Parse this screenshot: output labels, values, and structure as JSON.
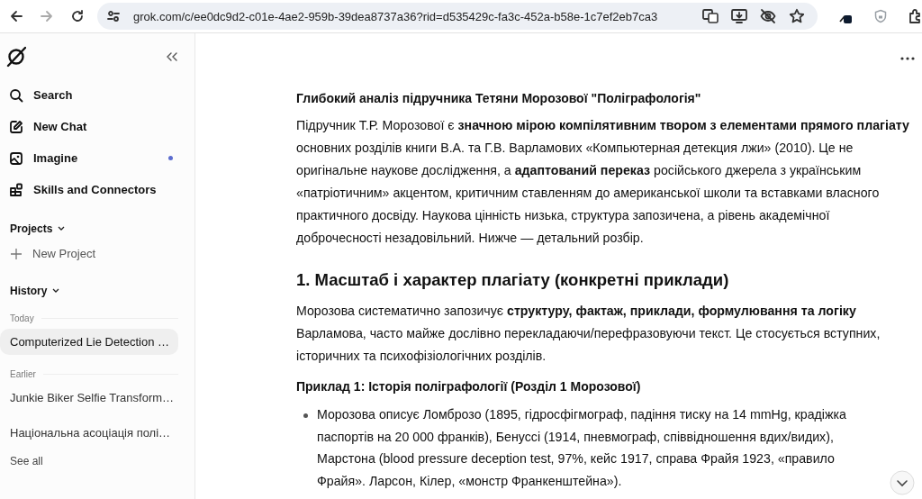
{
  "browser": {
    "url": "grok.com/c/ee0dc9d2-c01e-4ae2-959b-39dea8737a36?rid=d535429c-fa3c-452a-b58e-1c7ef2eb7ca3",
    "forward_disabled": true
  },
  "sidebar": {
    "nav": [
      {
        "label": "Search",
        "kind": "search",
        "dot": false
      },
      {
        "label": "New Chat",
        "kind": "edit",
        "dot": false
      },
      {
        "label": "Imagine",
        "kind": "image",
        "dot": true
      },
      {
        "label": "Skills and Connectors",
        "kind": "blocks",
        "dot": false
      }
    ],
    "projects": {
      "title": "Projects",
      "new_label": "New Project"
    },
    "history": {
      "title": "History",
      "groups": [
        {
          "label": "Today",
          "items": [
            {
              "title": "Computerized Lie Detection …",
              "selected": true
            }
          ]
        },
        {
          "label": "Earlier",
          "items": [
            {
              "title": "Junkie Biker Selfie Transform…",
              "selected": false
            },
            {
              "title": "Національна асоціація полі…",
              "selected": false
            }
          ]
        }
      ],
      "see_all": "See all"
    }
  },
  "content": [
    {
      "kind": "title",
      "text": "Глибокий аналіз підручника Тетяни Морозової \"Поліграфологія\""
    },
    {
      "kind": "paragraph",
      "text": "Підручник Т.Р. Морозової є **значною мірою компілятивним твором з елементами прямого плагіату** основних розділів книги В.А. та Г.В. Варламових «Компьютерная детекция лжи» (2010). Це не оригінальне наукове дослідження, а **адаптований переказ** російського джерела з українським «патріотичним» акцентом, критичним ставленням до американської школи та вставками власного практичного досвіду. Наукова цінність низька, структура запозичена, а рівень академічної доброчесності незадовільний. Нижче — детальний розбір."
    },
    {
      "kind": "heading",
      "text": "1. Масштаб і характер плагіату (конкретні приклади)"
    },
    {
      "kind": "paragraph",
      "text": "Морозова систематично запозичує **структуру, фактаж, приклади, формулювання та логіку** Варламова, часто майже дослівно перекладаючи/перефразовуючи текст. Це стосується вступних, історичних та психофізіологічних розділів."
    },
    {
      "kind": "subheading",
      "text": "Приклад 1: Історія поліграфології (Розділ 1 Морозової)"
    },
    {
      "kind": "bullet",
      "text": "Морозова описує Ломброзо (1895, гідросфігмограф, падіння тиску на 14 mmHg, крадіжка паспортів на 20 000 франків), Бенуссі (1914, пневмограф, співвідношення вдих/видих), Марстона (blood pressure deception test, 97%, кейс 1917, справа Фрайя 1923, «правило Фрайя». Ларсон, Кілер, «монстр Франкенштейна»)."
    }
  ]
}
